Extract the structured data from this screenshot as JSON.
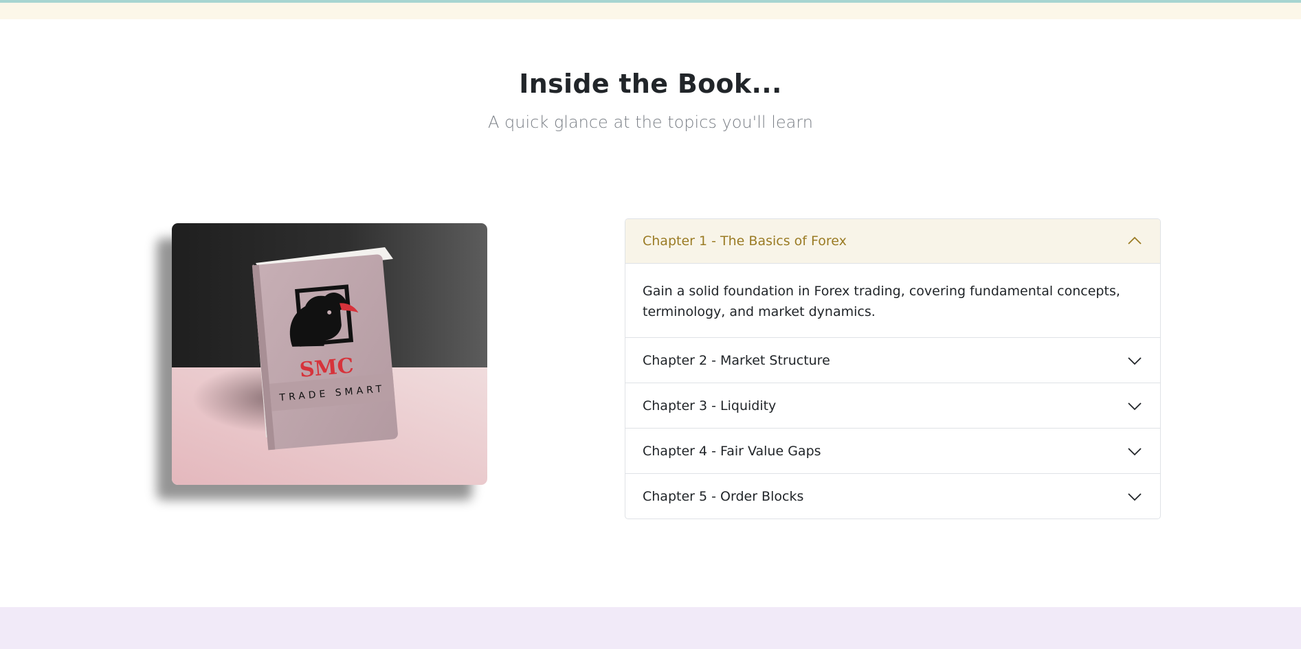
{
  "section": {
    "title": "Inside the Book...",
    "subtitle": "A quick glance at the topics you'll learn"
  },
  "book": {
    "brand": "SMC",
    "tagline": "TRADE SMART",
    "icon": "bull-logo-icon"
  },
  "accordion": {
    "items": [
      {
        "title": "Chapter 1 - The Basics of Forex",
        "open": true,
        "body": "Gain a solid foundation in Forex trading, covering fundamental concepts, terminology, and market dynamics."
      },
      {
        "title": "Chapter 2 - Market Structure",
        "open": false
      },
      {
        "title": "Chapter 3 - Liquidity",
        "open": false
      },
      {
        "title": "Chapter 4 - Fair Value Gaps",
        "open": false
      },
      {
        "title": "Chapter 5 - Order Blocks",
        "open": false
      }
    ]
  },
  "colors": {
    "active_accent": "#9a7b24",
    "active_header_bg": "#f8f4e8",
    "top_strip": "#fcf7e9",
    "bottom_strip": "#f1eaf8",
    "brand_red": "#d6333b"
  }
}
